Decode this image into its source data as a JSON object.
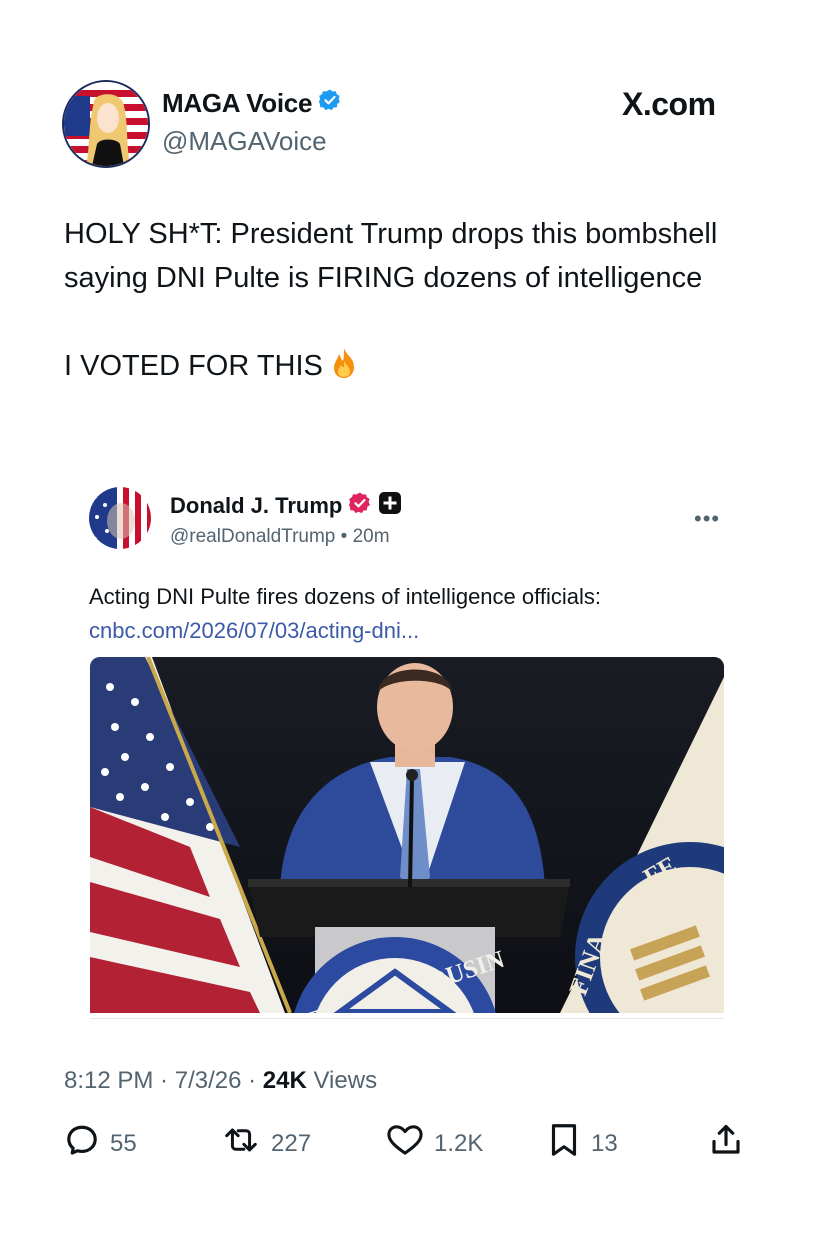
{
  "header": {
    "display_name": "MAGA Voice",
    "handle": "@MAGAVoice",
    "site_label": "X.com"
  },
  "tweet": {
    "line1": "HOLY SH*T: President Trump drops this bombshell saying DNI Pulte is FIRING dozens of intelligence",
    "line2": "I VOTED FOR THIS",
    "emoji_icon": "fire-emoji"
  },
  "quoted_post": {
    "display_name": "Donald J. Trump",
    "handle": "@realDonaldTrump",
    "separator": "•",
    "age": "20m",
    "more_label": "•••",
    "text": "Acting DNI Pulte fires dozens of intelligence officials:",
    "link": "cnbc.com/2026/07/03/acting-dni...",
    "image_seal_text": "EDERAL HOUSIN",
    "image_seal_right_text": "FE",
    "image_seal_right_text2": "FINA"
  },
  "meta": {
    "time": "8:12 PM",
    "dot1": " · ",
    "date": "7/3/26",
    "dot2": " · ",
    "views_count": "24K",
    "views_label": " Views"
  },
  "actions": {
    "replies": "55",
    "reposts": "227",
    "likes": "1.2K",
    "bookmarks": "13"
  },
  "colors": {
    "verified_blue": "#1d9bf0",
    "verified_pink": "#e0245e",
    "link": "#3b5aa8",
    "muted": "#536471"
  }
}
